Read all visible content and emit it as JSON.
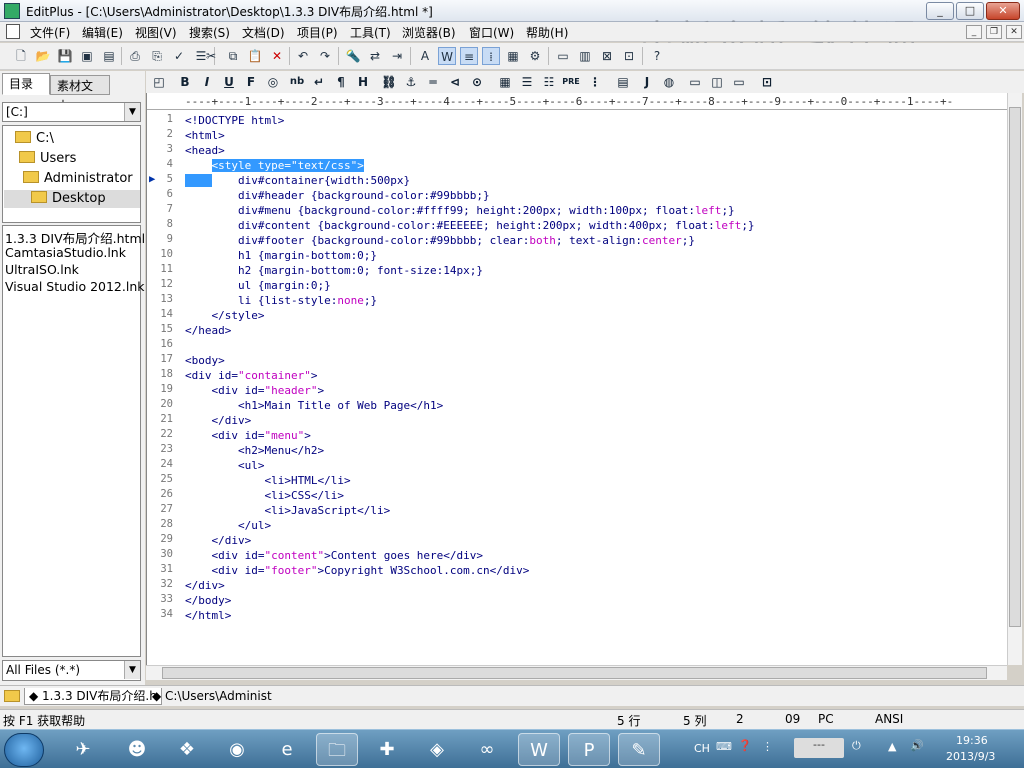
{
  "window": {
    "title": "EditPlus - [C:\\Users\\Administrator\\Desktop\\1.3.3 DIV布局介绍.html *]",
    "watermark": "中新金桥 软件通"
  },
  "menu": [
    "文件(F)",
    "编辑(E)",
    "视图(V)",
    "搜索(S)",
    "文档(D)",
    "项目(P)",
    "工具(T)",
    "浏览器(B)",
    "窗口(W)",
    "帮助(H)"
  ],
  "left_panel": {
    "tabs": [
      "目录",
      "素材文本"
    ],
    "drive": "[C:]",
    "tree": [
      "C:\\",
      "Users",
      "Administrator",
      "Desktop"
    ],
    "files": [
      "1.3.3 DIV布局介绍.html",
      "CamtasiaStudio.lnk",
      "UltraISO.lnk",
      "Visual Studio 2012.lnk"
    ],
    "filter": "All Files (*.*)"
  },
  "ruler": "----+----1----+----2----+----3----+----4----+----5----+----6----+----7----+----8----+----9----+----0----+----1----+-",
  "editor": {
    "current_line": 5,
    "lines": [
      "<!DOCTYPE html>",
      "<html>",
      "<head>",
      "    <style type=\"text/css\">",
      "        div#container{width:500px}",
      "        div#header {background-color:#99bbbb;}",
      "        div#menu {background-color:#ffff99; height:200px; width:100px; float:left;}",
      "        div#content {background-color:#EEEEEE; height:200px; width:400px; float:left;}",
      "        div#footer {background-color:#99bbbb; clear:both; text-align:center;}",
      "        h1 {margin-bottom:0;}",
      "        h2 {margin-bottom:0; font-size:14px;}",
      "        ul {margin:0;}",
      "        li {list-style:none;}",
      "    </style>",
      "</head>",
      "",
      "<body>",
      "<div id=\"container\">",
      "    <div id=\"header\">",
      "        <h1>Main Title of Web Page</h1>",
      "    </div>",
      "    <div id=\"menu\">",
      "        <h2>Menu</h2>",
      "        <ul>",
      "            <li>HTML</li>",
      "            <li>CSS</li>",
      "            <li>JavaScript</li>",
      "        </ul>",
      "    </div>",
      "    <div id=\"content\">Content goes here</div>",
      "    <div id=\"footer\">Copyright W3School.com.cn</div>",
      "</div>",
      "</body>",
      "</html>"
    ]
  },
  "doc_tabs": [
    "1.3.3 DIV布局介绍.h",
    "C:\\Users\\Administ"
  ],
  "status": {
    "help": "按 F1 获取帮助",
    "row": "5 行",
    "col": "5 列",
    "num": "2",
    "num2": "09",
    "encoding_os": "PC",
    "charset": "ANSI"
  },
  "taskbar": {
    "lang": "CH",
    "time": "19:36",
    "date": "2013/9/3"
  },
  "colors": {
    "selection": "#3399ff",
    "code": "#00007f",
    "attr_value": "#c000c0"
  }
}
